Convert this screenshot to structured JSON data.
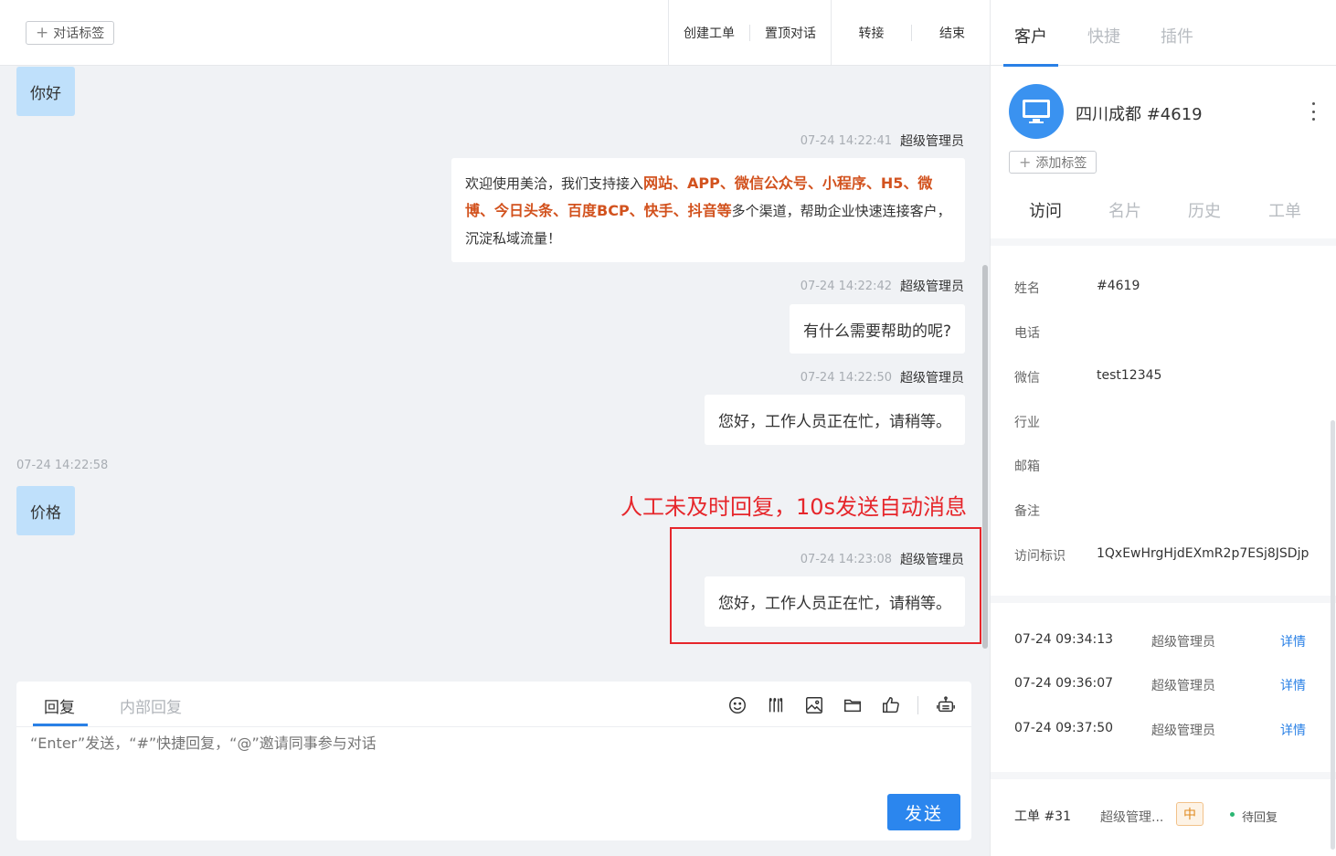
{
  "topbar": {
    "tag_button": "对话标签",
    "actions": [
      "创建工单",
      "置顶对话",
      "转接",
      "结束"
    ]
  },
  "messages": {
    "m1": {
      "text": "你好"
    },
    "m2": {
      "time": "07-24 14:22:41",
      "sender": "超级管理员",
      "parts": [
        "欢迎使用美洽，我们支持接入",
        "网站、APP、微信公众号、小程序、H5、微博、今日头条、百度BCP、快手、抖音等",
        "多个渠道，帮助企业快速连接客户，沉淀私域流量！"
      ]
    },
    "m3": {
      "time": "07-24 14:22:42",
      "sender": "超级管理员",
      "text": "有什么需要帮助的呢?"
    },
    "m4": {
      "time": "07-24 14:22:50",
      "sender": "超级管理员",
      "text": "您好，工作人员正在忙，请稍等。"
    },
    "m5": {
      "time": "07-24 14:22:58",
      "text": "价格"
    },
    "m6": {
      "time": "07-24 14:23:08",
      "sender": "超级管理员",
      "text": "您好，工作人员正在忙，请稍等。"
    }
  },
  "annotation": "人工未及时回复，10s发送自动消息",
  "reply": {
    "tabs": [
      "回复",
      "内部回复"
    ],
    "placeholder": "“Enter”发送，“#”快捷回复，“@”邀请同事参与对话",
    "send_label": "发送",
    "tools": [
      "smile-icon",
      "quick-reply-icon",
      "image-icon",
      "folder-icon",
      "thumbs-up-icon",
      "robot-icon"
    ]
  },
  "panel": {
    "tabs": [
      "客户",
      "快捷",
      "插件"
    ],
    "customer_name": "四川成都 #4619",
    "add_tag": "添加标签",
    "sub_tabs": [
      "访问",
      "名片",
      "历史",
      "工单"
    ],
    "fields": [
      {
        "label": "姓名",
        "value": "#4619"
      },
      {
        "label": "电话",
        "value": ""
      },
      {
        "label": "微信",
        "value": "test12345"
      },
      {
        "label": "行业",
        "value": ""
      },
      {
        "label": "邮箱",
        "value": ""
      },
      {
        "label": "备注",
        "value": ""
      },
      {
        "label": "访问标识",
        "value": "1QxEwHrgHjdEXmR2p7ESj8JSDjp"
      }
    ],
    "history": [
      {
        "time": "07-24 09:34:13",
        "who": "超级管理员",
        "link": "详情"
      },
      {
        "time": "07-24 09:36:07",
        "who": "超级管理员",
        "link": "详情"
      },
      {
        "time": "07-24 09:37:50",
        "who": "超级管理员",
        "link": "详情"
      }
    ],
    "ticket": {
      "id": "工单 #31",
      "who": "超级管理...",
      "priority": "中",
      "status": "待回复"
    }
  },
  "colors": {
    "accent": "#2980e6",
    "highlight": "#d2521e",
    "annotation": "#e6262b",
    "left_bubble": "#bfe0fb"
  }
}
